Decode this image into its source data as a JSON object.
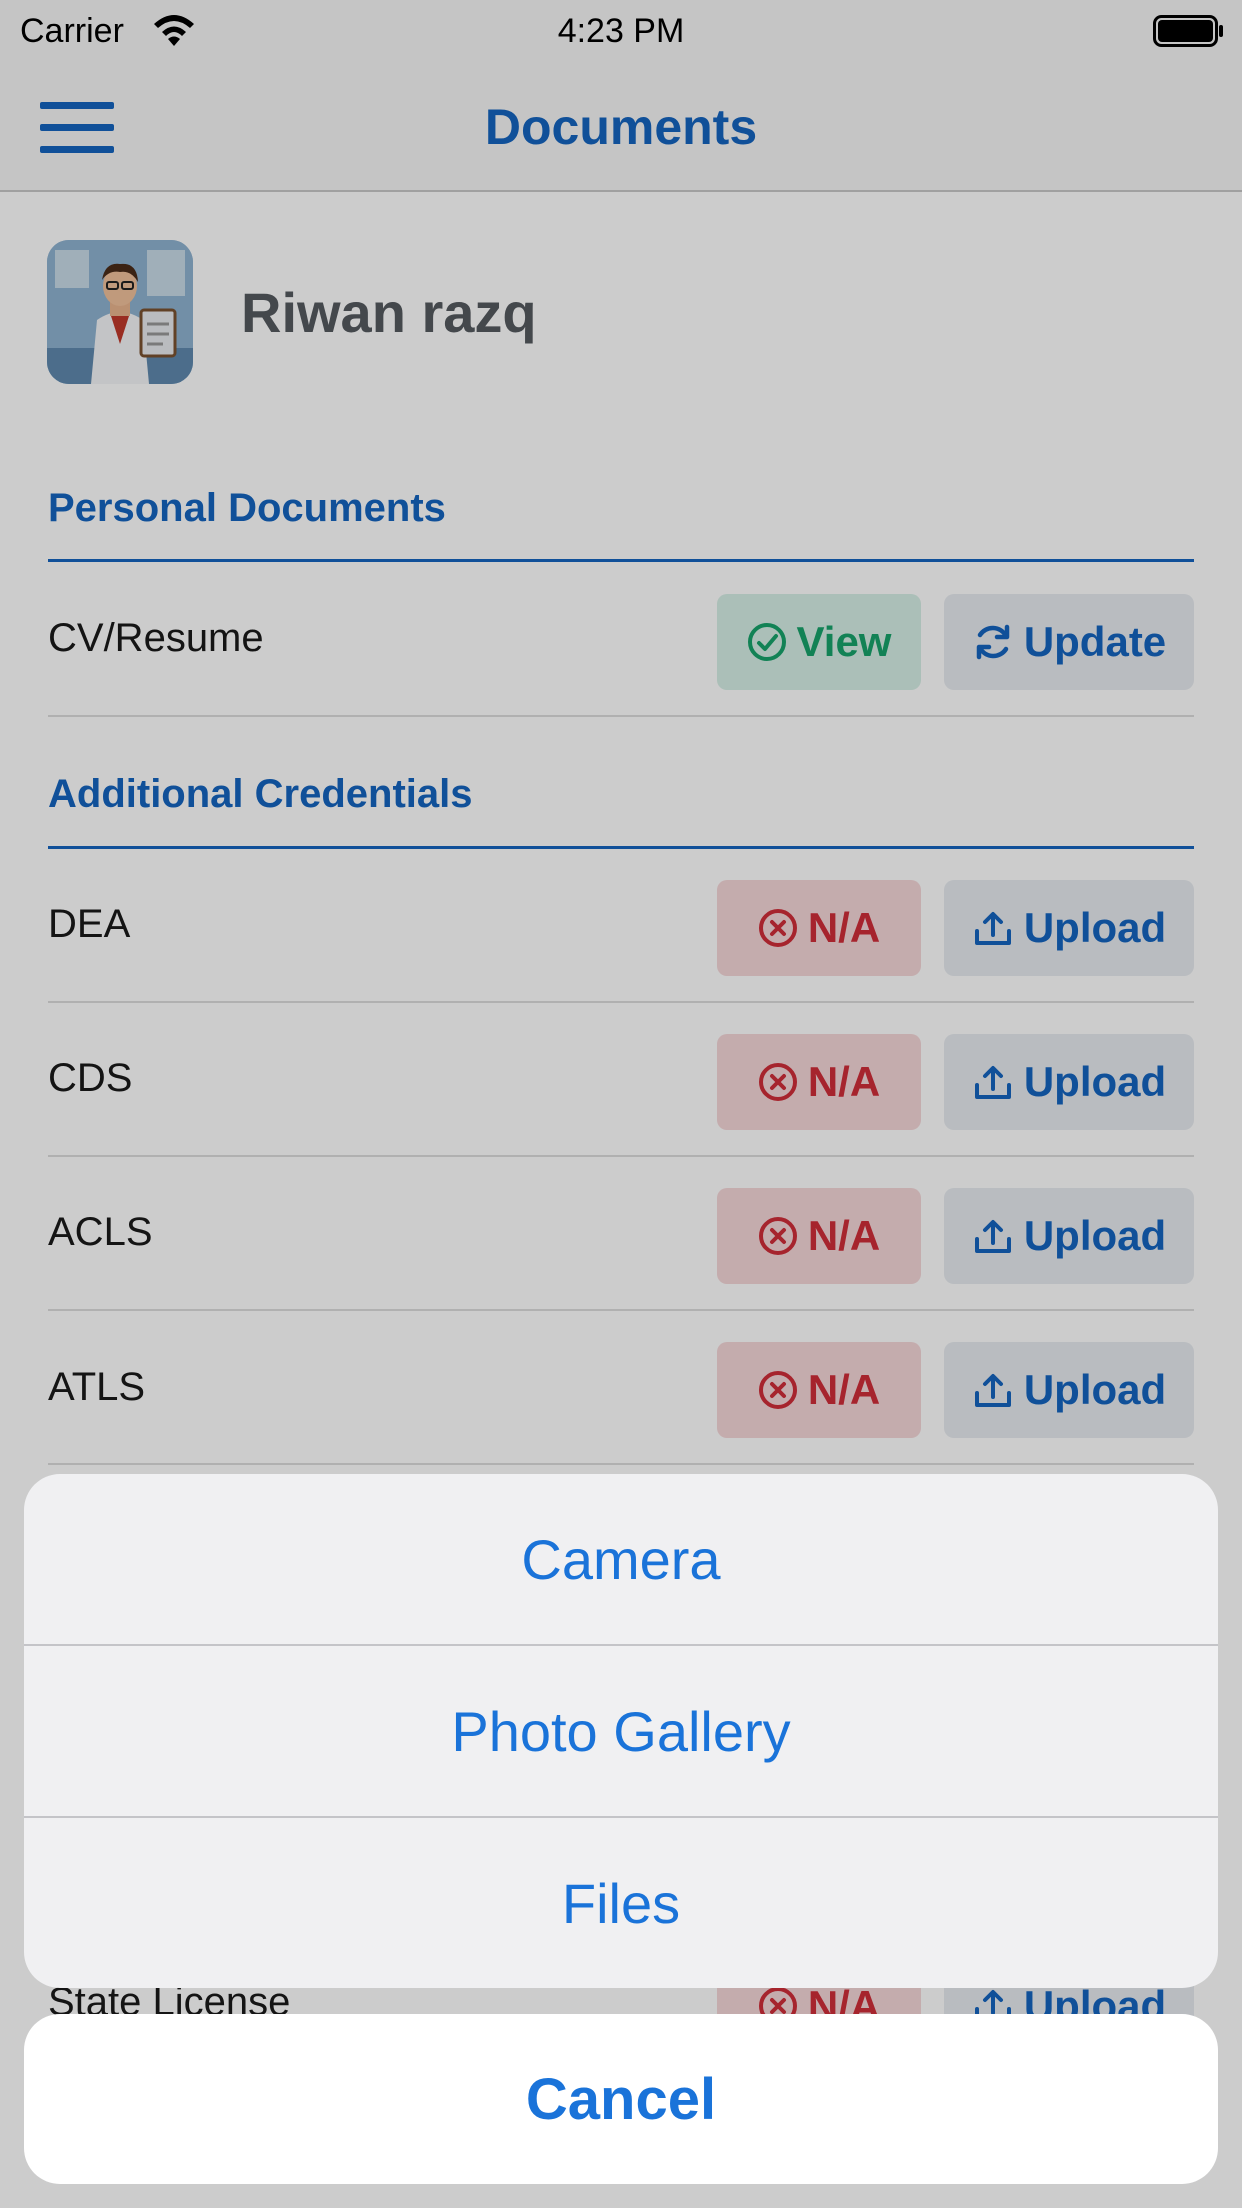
{
  "status_bar": {
    "carrier": "Carrier",
    "time": "4:23 PM"
  },
  "nav": {
    "title": "Documents"
  },
  "profile": {
    "name": "Riwan razq"
  },
  "sections": {
    "personal": {
      "title": "Personal Documents",
      "rows": [
        {
          "label": "CV/Resume",
          "status": "View",
          "action": "Update"
        }
      ]
    },
    "additional": {
      "title": "Additional Credentials",
      "rows": [
        {
          "label": "DEA",
          "status": "N/A",
          "action": "Upload"
        },
        {
          "label": "CDS",
          "status": "N/A",
          "action": "Upload"
        },
        {
          "label": "ACLS",
          "status": "N/A",
          "action": "Upload"
        },
        {
          "label": "ATLS",
          "status": "N/A",
          "action": "Upload"
        },
        {
          "label": "State License",
          "status": "N/A",
          "action": "Upload"
        }
      ]
    }
  },
  "action_sheet": {
    "options": [
      "Camera",
      "Photo Gallery",
      "Files"
    ],
    "cancel": "Cancel"
  },
  "colors": {
    "accent": "#1565c0",
    "success": "#17a36b",
    "danger": "#d02d39",
    "ios_blue": "#1a73d9"
  }
}
